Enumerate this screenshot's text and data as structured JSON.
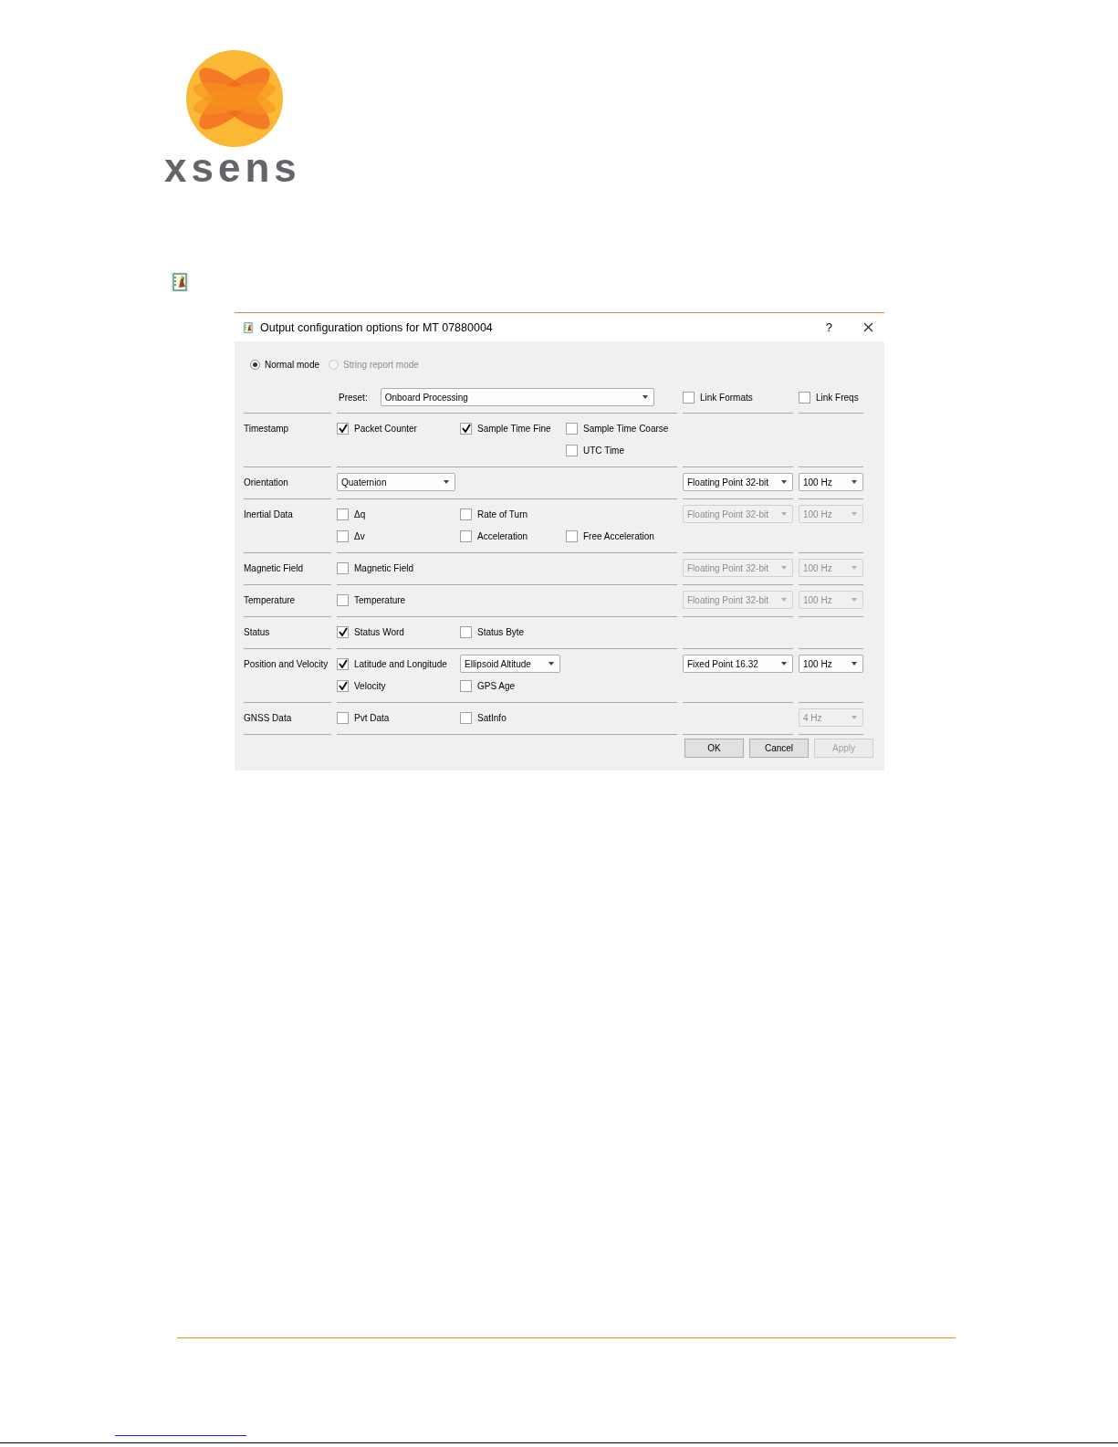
{
  "logo": {
    "wordmark": "xsens"
  },
  "dialog": {
    "title": "Output configuration options for MT 07880004",
    "help": "?"
  },
  "modes": [
    {
      "label": "Normal mode",
      "selected": true,
      "disabled": false
    },
    {
      "label": "String report mode",
      "selected": false,
      "disabled": true
    }
  ],
  "preset": {
    "label": "Preset:",
    "value": "Onboard Processing"
  },
  "links": [
    {
      "label": "Link Formats",
      "checked": false
    },
    {
      "label": "Link Freqs",
      "checked": false
    }
  ],
  "groups": [
    {
      "label": "Timestamp",
      "lines": [
        {
          "column_1": {
            "kind": "checkbox",
            "label": "Packet Counter",
            "checked": true
          },
          "column_2": {
            "kind": "checkbox",
            "label": "Sample Time Fine",
            "checked": true
          },
          "column_3": {
            "kind": "checkbox",
            "label": "Sample Time Coarse",
            "checked": false
          }
        },
        {
          "column_3": {
            "kind": "checkbox",
            "label": "UTC Time",
            "checked": false
          }
        }
      ]
    },
    {
      "label": "Orientation",
      "lines": [
        {
          "column_1": {
            "kind": "dropdown",
            "value": "Quaternion"
          }
        }
      ],
      "format": {
        "value": "Floating Point 32-bit",
        "disabled": false
      },
      "freq": {
        "value": "100 Hz",
        "disabled": false
      }
    },
    {
      "label": "Inertial Data",
      "lines": [
        {
          "column_1": {
            "kind": "checkbox",
            "label": "Δq",
            "checked": false
          },
          "column_2": {
            "kind": "checkbox",
            "label": "Rate of Turn",
            "checked": false
          }
        },
        {
          "column_1": {
            "kind": "checkbox",
            "label": "Δv",
            "checked": false
          },
          "column_2": {
            "kind": "checkbox",
            "label": "Acceleration",
            "checked": false
          },
          "column_3": {
            "kind": "checkbox",
            "label": "Free Acceleration",
            "checked": false
          }
        }
      ],
      "format": {
        "value": "Floating Point 32-bit",
        "disabled": true
      },
      "freq": {
        "value": "100 Hz",
        "disabled": true
      }
    },
    {
      "label": "Magnetic Field",
      "lines": [
        {
          "column_1": {
            "kind": "checkbox",
            "label": "Magnetic Field",
            "checked": false
          }
        }
      ],
      "format": {
        "value": "Floating Point 32-bit",
        "disabled": true
      },
      "freq": {
        "value": "100 Hz",
        "disabled": true
      }
    },
    {
      "label": "Temperature",
      "lines": [
        {
          "column_1": {
            "kind": "checkbox",
            "label": "Temperature",
            "checked": false
          }
        }
      ],
      "format": {
        "value": "Floating Point 32-bit",
        "disabled": true
      },
      "freq": {
        "value": "100 Hz",
        "disabled": true
      }
    },
    {
      "label": "Status",
      "lines": [
        {
          "column_1": {
            "kind": "checkbox",
            "label": "Status Word",
            "checked": true
          },
          "column_2": {
            "kind": "checkbox",
            "label": "Status Byte",
            "checked": false
          }
        }
      ]
    },
    {
      "label": "Position and Velocity",
      "lines": [
        {
          "column_1": {
            "kind": "checkbox",
            "label": "Latitude and Longitude",
            "checked": true
          },
          "column_2": {
            "kind": "dropdown",
            "value": "Ellipsoid Altitude"
          }
        },
        {
          "column_1": {
            "kind": "checkbox",
            "label": "Velocity",
            "checked": true
          },
          "column_2": {
            "kind": "checkbox",
            "label": "GPS Age",
            "checked": false
          }
        }
      ],
      "format": {
        "value": "Fixed Point 16.32",
        "disabled": false
      },
      "freq": {
        "value": "100 Hz",
        "disabled": false
      }
    },
    {
      "label": "GNSS Data",
      "lines": [
        {
          "column_1": {
            "kind": "checkbox",
            "label": "Pvt Data",
            "checked": false
          },
          "column_2": {
            "kind": "checkbox",
            "label": "SatInfo",
            "checked": false
          }
        }
      ],
      "freq": {
        "value": "4 Hz",
        "disabled": true
      }
    }
  ],
  "buttons": [
    {
      "label": "OK",
      "disabled": false
    },
    {
      "label": "Cancel",
      "disabled": false
    },
    {
      "label": "Apply",
      "disabled": true
    }
  ]
}
